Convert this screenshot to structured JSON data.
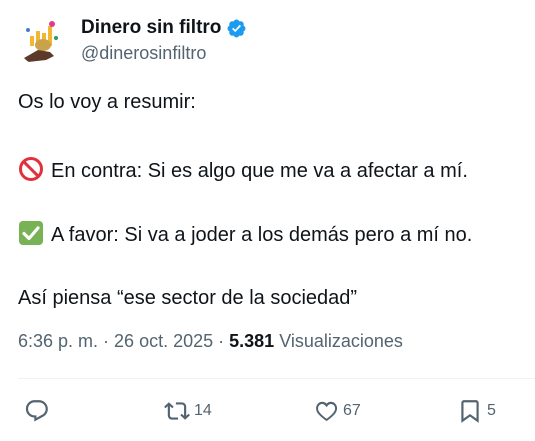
{
  "author": {
    "display_name": "Dinero sin filtro",
    "handle": "@dinerosinfiltro",
    "verified_icon": "verified-badge-icon"
  },
  "tweet": {
    "lines": [
      {
        "text": "Os lo voy a resumir:"
      },
      {
        "icon": "prohibited-icon",
        "text": "En contra:  Si es algo que me va a afectar a mí."
      },
      {
        "icon": "check-mark-icon",
        "text": "A favor: Si va a joder a los demás pero a mí no."
      },
      {
        "text": "Así piensa “ese sector de la sociedad”"
      }
    ]
  },
  "meta": {
    "time": "6:36 p. m.",
    "sep1": " · ",
    "date": "26 oct. 2025",
    "sep2": " · ",
    "views_count": "5.381",
    "views_label": " Visualizaciones"
  },
  "actions": {
    "reply": {
      "icon": "reply-icon",
      "count": ""
    },
    "retweet": {
      "icon": "retweet-icon",
      "count": "14"
    },
    "like": {
      "icon": "heart-icon",
      "count": "67"
    },
    "bookmark": {
      "icon": "bookmark-icon",
      "count": "5"
    }
  },
  "colors": {
    "text": "#0f1419",
    "secondary": "#536471",
    "verified": "#1d9bf0",
    "divider": "#eff3f4"
  }
}
